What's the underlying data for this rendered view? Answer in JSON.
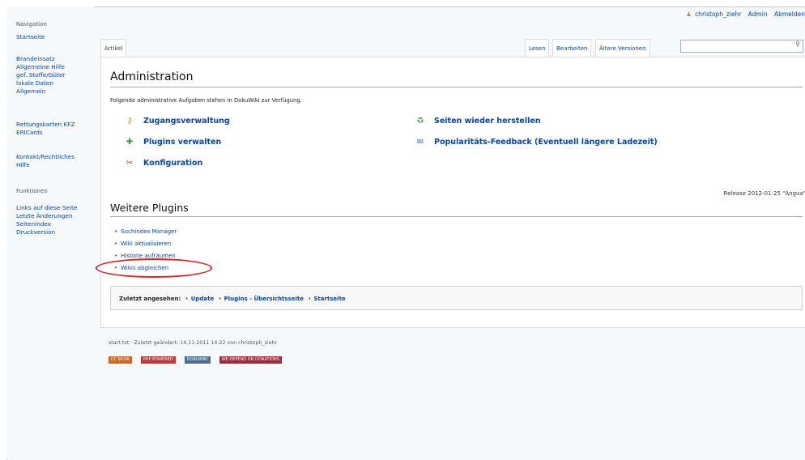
{
  "sidebar": {
    "navigation_title": "Navigation",
    "nav_links": [
      "Startseite"
    ],
    "group1": [
      "Brandeinsatz",
      "Allgemeine Hilfe",
      "gef. Stoffe/Güter",
      "lokale Daten",
      "Allgemein"
    ],
    "group2": [
      "Rettungskarten KFZ",
      "ERICards"
    ],
    "group3": [
      "Kontakt/Rechtliches",
      "Hilfe"
    ],
    "functions_title": "Funktionen",
    "group4": [
      "Links auf diese Seite",
      "Letzte Änderungen",
      "Seitenindex",
      "Druckversion"
    ]
  },
  "topbar": {
    "user": "christoph_ziehr",
    "admin": "Admin",
    "logout": "Abmelden"
  },
  "tabs": {
    "article": "Artikel",
    "read": "Lesen",
    "edit": "Bearbeiten",
    "history": "Ältere Versionen"
  },
  "search": {
    "placeholder": ""
  },
  "main": {
    "title": "Administration",
    "intro": "Folgende administrative Aufgaben stehen in DokuWiki zur Verfügung.",
    "admin_left": [
      "Zugangsverwaltung",
      "Plugins verwalten",
      "Konfiguration"
    ],
    "admin_right": [
      "Seiten wieder herstellen",
      "Popularitäts-Feedback (Eventuell längere Ladezeit)"
    ],
    "release": "Release 2012-01-25 \"Angua\"",
    "plugins_title": "Weitere Plugins",
    "plugins": [
      "Suchindex Manager",
      "Wiki aktualisieren",
      "Historie aufräumen",
      "Wikis abgleichen"
    ],
    "breadcrumb_label": "Zuletzt angesehen:",
    "breadcrumbs": [
      "Update",
      "Plugins - Übersichtsseite",
      "Startseite"
    ]
  },
  "footer": {
    "info": "start.txt · Zuletzt geändert: 14.11.2011 14:22 von christoph_ziehr",
    "badges": [
      "CC BY-SA",
      "PHP POWERED",
      "DOKUWIKI",
      "WE DEPEND ON DONATIONS"
    ]
  },
  "colors": {
    "link": "#0645ad",
    "highlight_ellipse": "#d7262b"
  }
}
